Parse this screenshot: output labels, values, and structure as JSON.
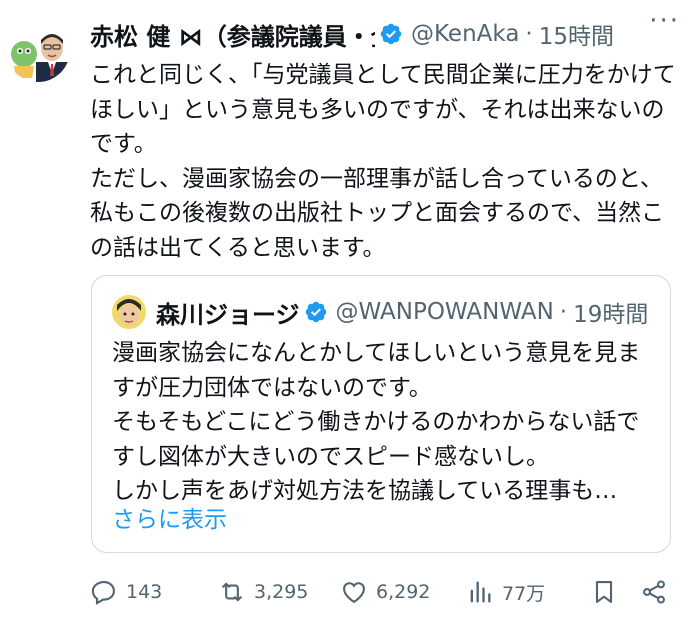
{
  "tweet": {
    "author_name": "赤松 健 ⋈（参議院議員・全",
    "handle": "@KenAka",
    "separator": "·",
    "time": "15時間",
    "more_label": "···",
    "text": "これと同じく、「与党議員として民間企業に圧力をかけてほしい」という意見も多いのですが、それは出来ないのです。\nただし、漫画家協会の一部理事が話し合っているのと、私もこの後複数の出版社トップと面会するので、当然この話は出てくると思います。"
  },
  "quote": {
    "author_name": "森川ジョージ",
    "handle": "@WANPOWANWAN",
    "separator": "·",
    "time": "19時間",
    "text": "漫画家協会になんとかしてほしいという意見を見ますが圧力団体ではないのです。\nそもそもどこにどう働きかけるのかわからない話ですし図体が大きいのでスピード感ないし。\nしかし声をあげ対処方法を協議している理事も…",
    "show_more": "さらに表示"
  },
  "actions": {
    "replies": "143",
    "retweets": "3,295",
    "likes": "6,292",
    "views": "77万"
  },
  "icons": [
    "verified-badge-icon",
    "reply-icon",
    "retweet-icon",
    "like-icon",
    "views-icon",
    "bookmark-icon",
    "share-icon",
    "more-icon"
  ],
  "colors": {
    "accent": "#1d9bf0",
    "muted": "#536471",
    "text": "#0f1419",
    "border": "#cfd9de"
  }
}
